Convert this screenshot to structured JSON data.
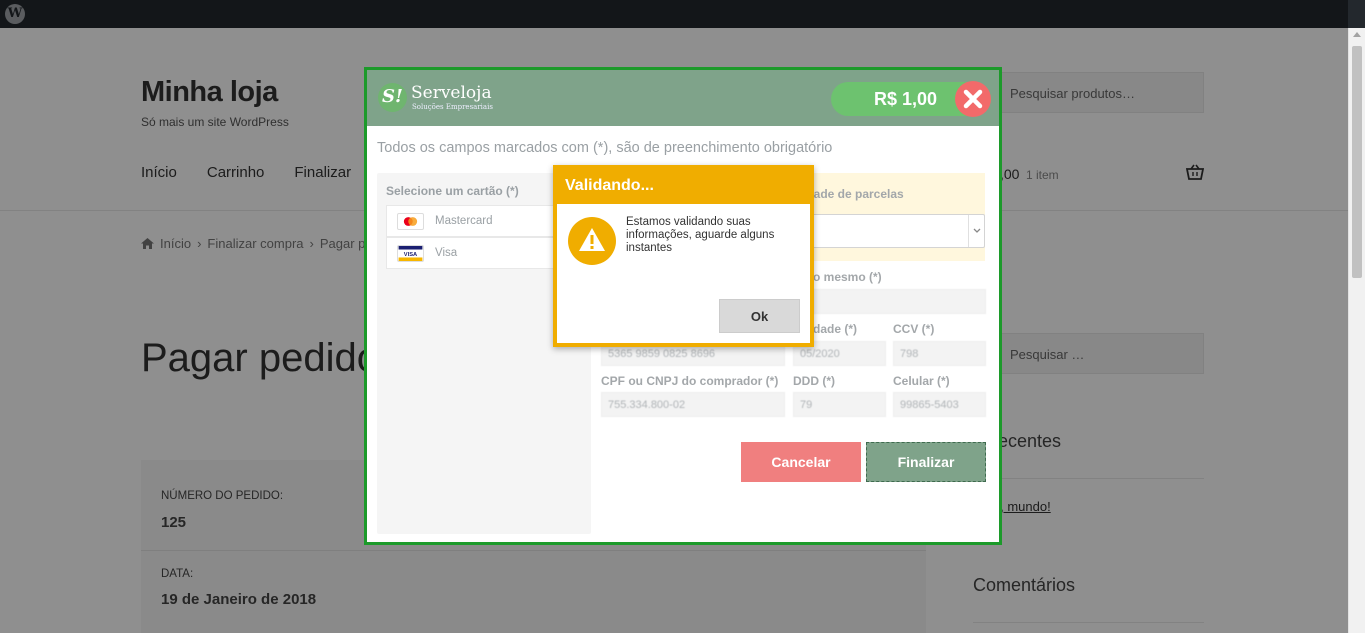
{
  "admin_bar": {
    "logo_icon": "wordpress-icon"
  },
  "site": {
    "title": "Minha loja",
    "tagline": "Só mais um site WordPress",
    "search_placeholder": "Pesquisar produtos…"
  },
  "nav": {
    "items": [
      "Início",
      "Carrinho",
      "Finalizar"
    ],
    "cart_total": ",00",
    "cart_count": "1 item"
  },
  "breadcrumb": [
    "Início",
    "Finalizar compra",
    "Pagar p"
  ],
  "page_title": "Pagar pedido",
  "order": {
    "number_label": "NÚMERO DO PEDIDO:",
    "number_value": "125",
    "date_label": "DATA:",
    "date_value": "19 de Janeiro de 2018"
  },
  "sidebar": {
    "search_placeholder": "Pesquisar …",
    "recent_title": "ts recentes",
    "recent_link": "lá, mundo!",
    "comments_title": "Comentários"
  },
  "modal": {
    "brand_name": "Serveloja",
    "brand_sub": "Soluções Empresariais",
    "brand_badge": "S!",
    "price": "R$ 1,00",
    "required_note": "Todos os campos marcados com (*), são de preenchimento obrigatório",
    "card_select_label": "Selecione um cartão (*)",
    "cards": [
      "Mastercard",
      "Visa"
    ],
    "parcelas_label": "tidade de parcelas",
    "holder_label": "o mesmo (*)",
    "validade_label": "dade (*)",
    "ccv_label": "CCV (*)",
    "card_number_value": "5365 9859 0825 8696",
    "validade_value": "05/2020",
    "ccv_value": "798",
    "cpf_label": "CPF ou CNPJ do comprador (*)",
    "ddd_label": "DDD (*)",
    "celular_label": "Celular (*)",
    "cpf_value": "755.334.800-02",
    "ddd_value": "79",
    "celular_value": "99865-5403",
    "cancel_label": "Cancelar",
    "finish_label": "Finalizar"
  },
  "alert": {
    "title": "Validando...",
    "message": "Estamos validando suas informações, aguarde alguns instantes",
    "ok_label": "Ok",
    "icon": "warning-icon"
  },
  "colors": {
    "modal_border": "#1c9a2a",
    "header_green": "#7fa38a",
    "price_green": "#6dc26f",
    "close_red": "#f26a6a",
    "alert_orange": "#f0ad00",
    "cancel_red": "#f07f7f"
  }
}
